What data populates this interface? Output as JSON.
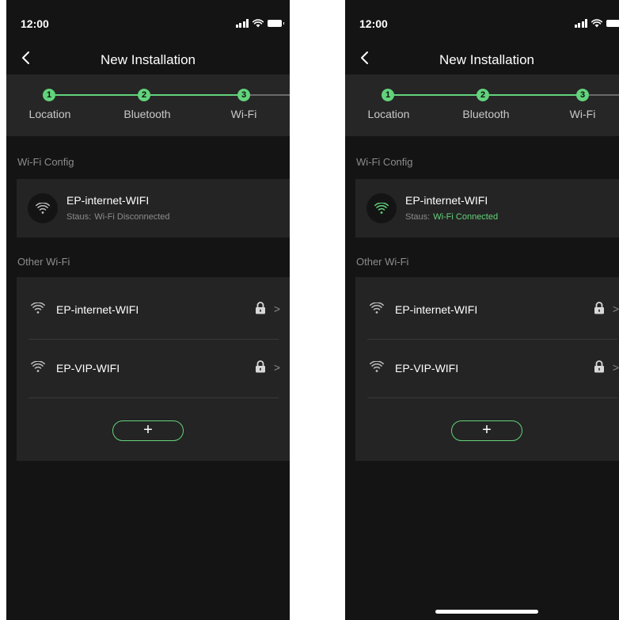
{
  "colors": {
    "background": "#141414",
    "card": "#242424",
    "stepper_bg": "#262626",
    "accent_green": "#62d37c",
    "muted_text": "#8c8c8c"
  },
  "screens": [
    {
      "status_bar": {
        "time": "12:00"
      },
      "nav": {
        "title": "New Installation",
        "back_icon": "chevron-left-icon"
      },
      "stepper": {
        "steps": [
          {
            "number": "1",
            "label": "Location"
          },
          {
            "number": "2",
            "label": "Bluetooth"
          },
          {
            "number": "3",
            "label": "Wi-Fi"
          }
        ]
      },
      "wifi_config": {
        "section_label": "Wi-Fi Config",
        "network_name": "EP-internet-WIFI",
        "status_prefix": "Staus:",
        "status_value": "Wi-Fi Disconnected",
        "connected": false
      },
      "other_wifi": {
        "section_label": "Other Wi-Fi",
        "networks": [
          {
            "name": "EP-internet-WIFI"
          },
          {
            "name": "EP-VIP-WIFI"
          }
        ],
        "add_label": "+"
      }
    },
    {
      "status_bar": {
        "time": "12:00"
      },
      "nav": {
        "title": "New Installation",
        "back_icon": "chevron-left-icon"
      },
      "stepper": {
        "steps": [
          {
            "number": "1",
            "label": "Location"
          },
          {
            "number": "2",
            "label": "Bluetooth"
          },
          {
            "number": "3",
            "label": "Wi-Fi"
          }
        ]
      },
      "wifi_config": {
        "section_label": "Wi-Fi Config",
        "network_name": "EP-internet-WIFI",
        "status_prefix": "Staus:",
        "status_value": "Wi-Fi Connected",
        "connected": true
      },
      "other_wifi": {
        "section_label": "Other Wi-Fi",
        "networks": [
          {
            "name": "EP-internet-WIFI"
          },
          {
            "name": "EP-VIP-WIFI"
          }
        ],
        "add_label": "+"
      }
    }
  ]
}
